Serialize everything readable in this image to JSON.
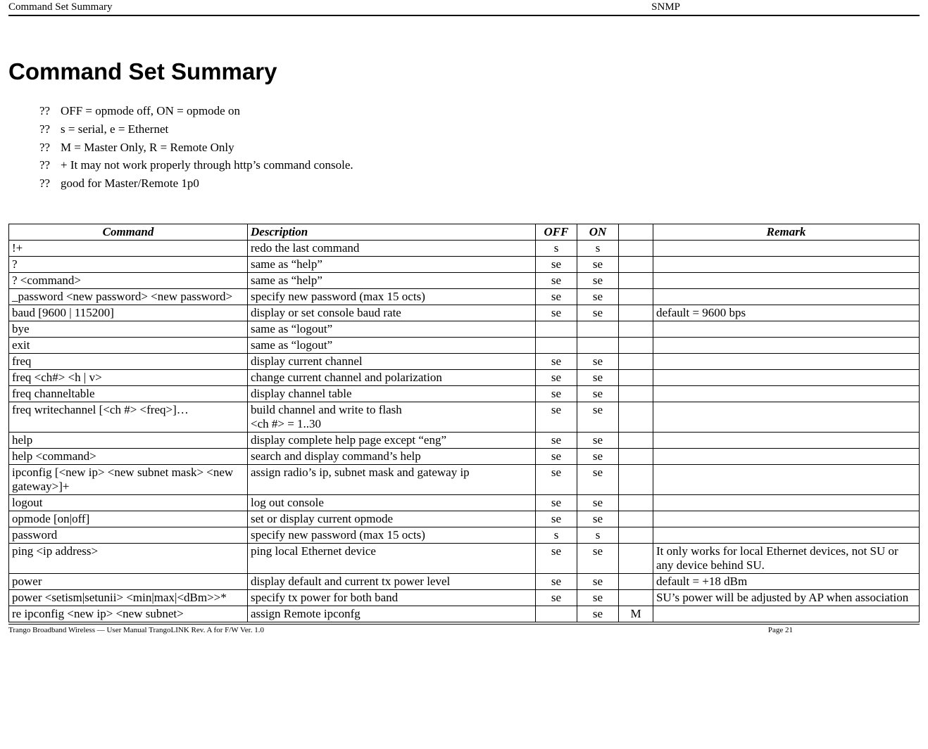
{
  "header": {
    "left": "Command Set Summary",
    "right": "SNMP"
  },
  "title": "Command Set Summary",
  "notes": [
    "OFF = opmode off, ON = opmode on",
    "s = serial, e = Ethernet",
    "M = Master Only, R = Remote Only",
    "+ It may not work properly through http’s command console.",
    "good for Master/Remote 1p0"
  ],
  "table": {
    "headers": {
      "command": "Command",
      "description": "Description",
      "off": "OFF",
      "on": "ON",
      "mr": "",
      "remark": "Remark"
    },
    "rows": [
      {
        "command": "!+",
        "description": "redo the last command",
        "off": "s",
        "on": "s",
        "mr": "",
        "remark": ""
      },
      {
        "command": "?",
        "description": "same as “help”",
        "off": "se",
        "on": "se",
        "mr": "",
        "remark": ""
      },
      {
        "command": "? <command>",
        "description": "same as “help”",
        "off": "se",
        "on": "se",
        "mr": "",
        "remark": ""
      },
      {
        "command": "_password <new password> <new password>",
        "description": "specify new password (max 15 octs)",
        "off": "se",
        "on": "se",
        "mr": "",
        "remark": ""
      },
      {
        "command": "baud [9600 | 115200]",
        "description": "display or set console baud rate",
        "off": "se",
        "on": "se",
        "mr": "",
        "remark": "default = 9600 bps"
      },
      {
        "command": "bye",
        "description": "same as “logout”",
        "off": "",
        "on": "",
        "mr": "",
        "remark": ""
      },
      {
        "command": "exit",
        "description": "same as “logout”",
        "off": "",
        "on": "",
        "mr": "",
        "remark": ""
      },
      {
        "command": "freq",
        "description": "display current channel",
        "off": "se",
        "on": "se",
        "mr": "",
        "remark": ""
      },
      {
        "command": "freq <ch#> <h | v>",
        "description": "change current channel and polarization",
        "off": "se",
        "on": "se",
        "mr": "",
        "remark": ""
      },
      {
        "command": "freq channeltable",
        "description": "display channel table",
        "off": "se",
        "on": "se",
        "mr": "",
        "remark": ""
      },
      {
        "command": "freq writechannel [<ch #> <freq>]…",
        "description": "build channel and write to flash\n<ch #> = 1..30",
        "off": "se",
        "on": "se",
        "mr": "",
        "remark": ""
      },
      {
        "command": "help",
        "description": "display complete help page except “eng”",
        "off": "se",
        "on": "se",
        "mr": "",
        "remark": ""
      },
      {
        "command": "help <command>",
        "description": "search and display command’s help",
        "off": "se",
        "on": "se",
        "mr": "",
        "remark": ""
      },
      {
        "command": "ipconfig [<new ip> <new subnet mask> <new gateway>]+",
        "description": "assign radio’s ip, subnet mask and gateway ip",
        "off": "se",
        "on": "se",
        "mr": "",
        "remark": ""
      },
      {
        "command": "logout",
        "description": "log out console",
        "off": "se",
        "on": "se",
        "mr": "",
        "remark": ""
      },
      {
        "command": "opmode [on|off]",
        "description": "set or display current opmode",
        "off": "se",
        "on": "se",
        "mr": "",
        "remark": ""
      },
      {
        "command": "password",
        "description": "specify new password (max 15 octs)",
        "off": "s",
        "on": "s",
        "mr": "",
        "remark": ""
      },
      {
        "command": "ping <ip address>",
        "description": "ping local Ethernet device",
        "off": "se",
        "on": "se",
        "mr": "",
        "remark": "It only works for local Ethernet devices, not SU or any device behind SU."
      },
      {
        "command": "power",
        "description": "display default and current tx power level",
        "off": "se",
        "on": "se",
        "mr": "",
        "remark": "default = +18 dBm"
      },
      {
        "command": "power <setism|setunii> <min|max|<dBm>>*",
        "description": "specify tx power for both band",
        "off": "se",
        "on": "se",
        "mr": "",
        "remark": "SU’s power will be adjusted by AP when association"
      },
      {
        "command": "re ipconfig <new ip> <new subnet>",
        "description": "assign Remote ipconfg",
        "off": "",
        "on": "se",
        "mr": "M",
        "remark": ""
      }
    ]
  },
  "footer": {
    "left": "Trango Broadband Wireless — User Manual TrangoLINK  Rev. A  for F/W Ver. 1.0",
    "right": "Page 21"
  }
}
